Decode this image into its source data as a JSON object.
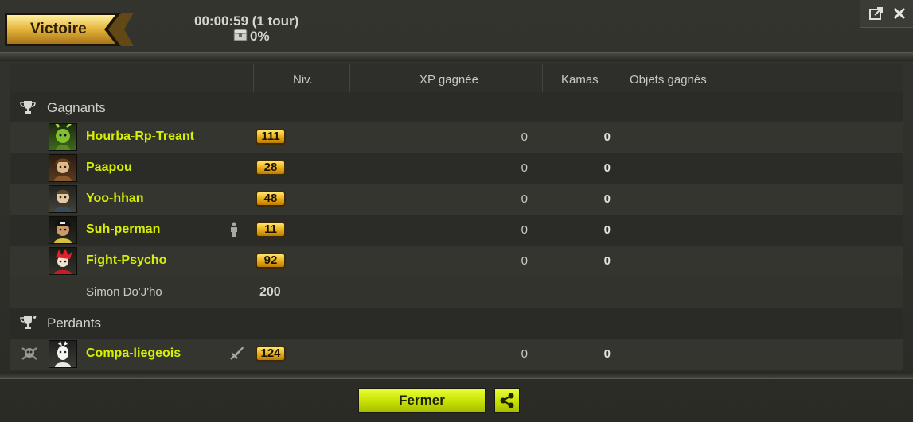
{
  "header": {
    "result_label": "Victoire",
    "timer": "00:00:59 (1 tour)",
    "chest_percent": "0%",
    "chest_icon": "chest-icon"
  },
  "window_buttons": {
    "detach_icon": "detach-icon",
    "close_icon": "close-icon"
  },
  "columns": {
    "level": "Niv.",
    "xp": "XP gagnée",
    "kamas": "Kamas",
    "items": "Objets gagnés"
  },
  "winners": {
    "label": "Gagnants",
    "players": [
      {
        "name": "Hourba-Rp-Treant",
        "level": "111",
        "xp": "0",
        "kamas": "0"
      },
      {
        "name": "Paapou",
        "level": "28",
        "xp": "0",
        "kamas": "0"
      },
      {
        "name": "Yoo-hhan",
        "level": "48",
        "xp": "0",
        "kamas": "0"
      },
      {
        "name": "Suh-perman",
        "level": "11",
        "xp": "0",
        "kamas": "0",
        "icon": "person-icon"
      },
      {
        "name": "Fight-Psycho",
        "level": "92",
        "xp": "0",
        "kamas": "0"
      }
    ],
    "npc": {
      "name": "Simon Do'J'ho",
      "level": "200"
    }
  },
  "losers": {
    "label": "Perdants",
    "players": [
      {
        "name": "Compa-liegeois",
        "level": "124",
        "xp": "0",
        "kamas": "0",
        "icon": "sword-icon",
        "status_icon": "skull-icon"
      }
    ]
  },
  "footer": {
    "close_label": "Fermer",
    "share_icon": "share-icon"
  },
  "colors": {
    "accent_green": "#c6e000",
    "player_name": "#d7f000",
    "level_badge": "#e4a510",
    "banner_gold": "#d9a72a"
  }
}
